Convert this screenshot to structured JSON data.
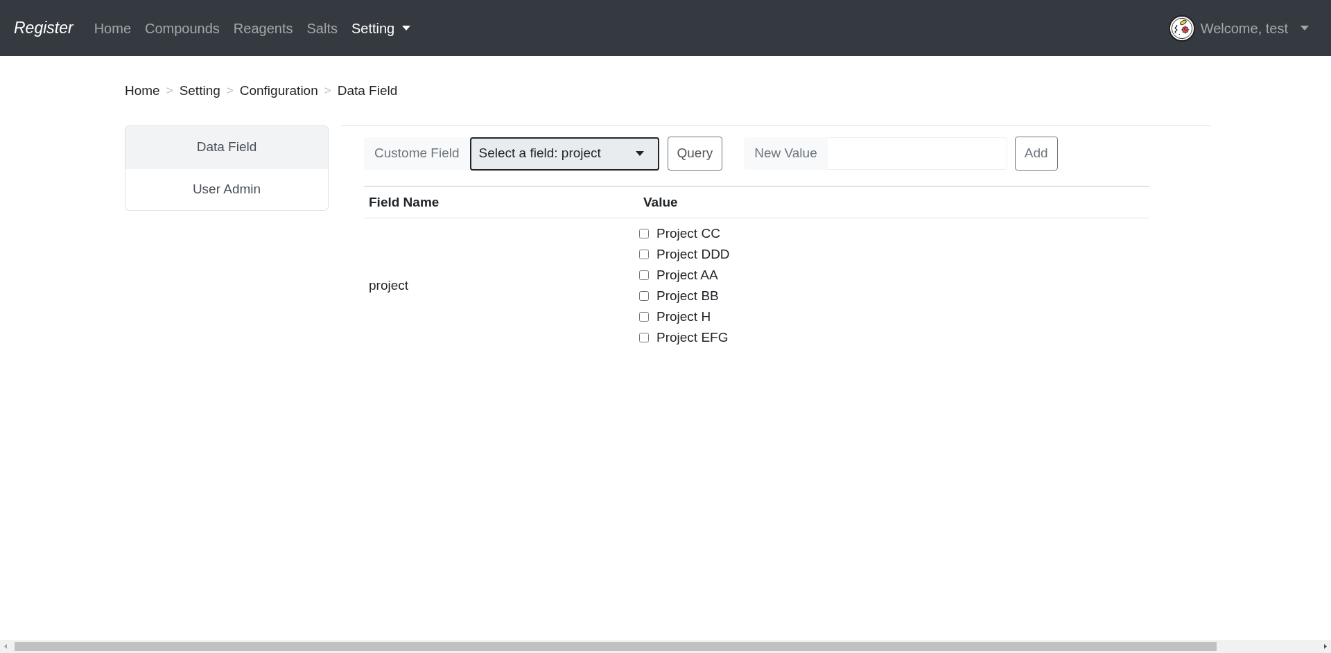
{
  "navbar": {
    "brand": "Register",
    "links": [
      {
        "label": "Home",
        "kind": "link",
        "selected": false
      },
      {
        "label": "Compounds",
        "kind": "link",
        "selected": false
      },
      {
        "label": "Reagents",
        "kind": "link",
        "selected": false
      },
      {
        "label": "Salts",
        "kind": "link",
        "selected": false
      },
      {
        "label": "Setting",
        "kind": "dropdown",
        "selected": true
      }
    ],
    "user": {
      "label": "Welcome, test"
    }
  },
  "breadcrumb": {
    "separator": ">",
    "items": [
      "Home",
      "Setting",
      "Configuration",
      "Data Field"
    ]
  },
  "sidebar": {
    "items": [
      {
        "label": "Data Field",
        "selected": true
      },
      {
        "label": "User Admin",
        "selected": false
      }
    ]
  },
  "toolbar": {
    "field_label": "Custome Field",
    "select": {
      "value": "Select a field: project"
    },
    "query_button": "Query",
    "new_value": {
      "label": "New Value"
    },
    "add_button": "Add"
  },
  "table": {
    "columns": [
      "Field Name",
      "Value"
    ],
    "rows": [
      {
        "field_name": "project",
        "values": [
          {
            "label": "Project CC",
            "checked": false
          },
          {
            "label": "Project DDD",
            "checked": false
          },
          {
            "label": "Project AA",
            "checked": false
          },
          {
            "label": "Project BB",
            "checked": false
          },
          {
            "label": "Project H",
            "checked": false
          },
          {
            "label": "Project EFG",
            "checked": false
          }
        ]
      }
    ]
  }
}
